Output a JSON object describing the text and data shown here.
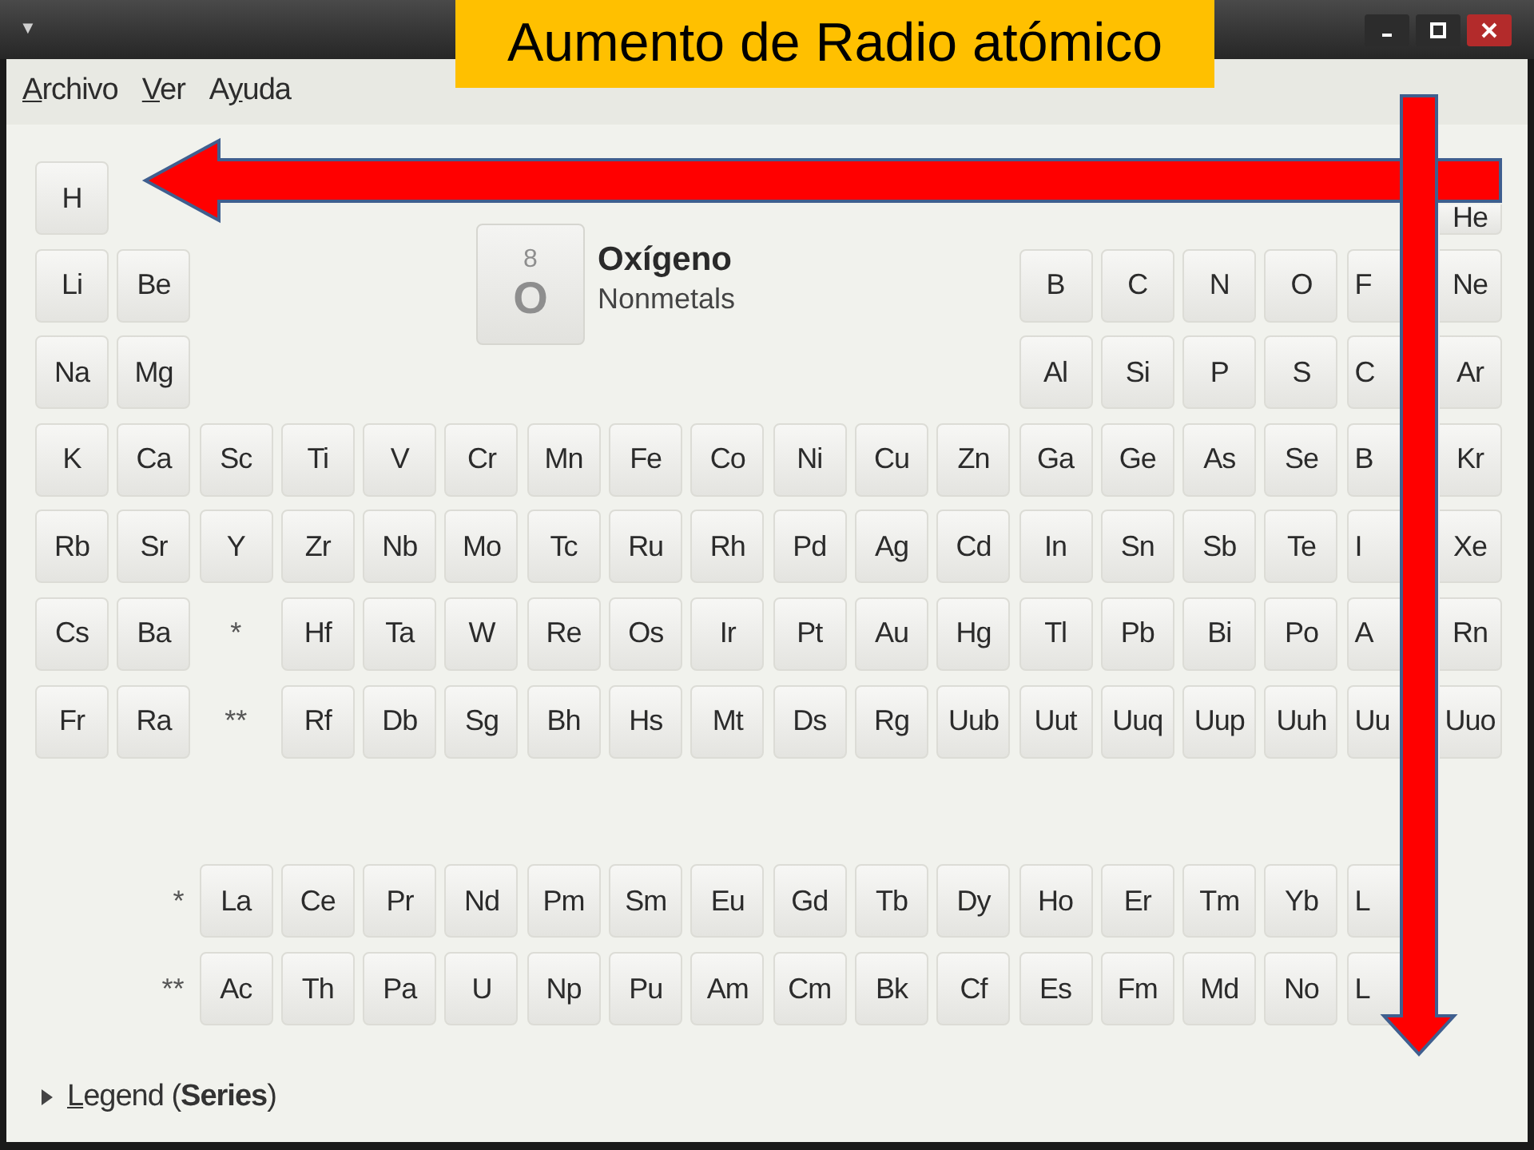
{
  "annotation": {
    "title": "Aumento de Radio atómico"
  },
  "window": {
    "menu_glyph": "▼",
    "controls": [
      {
        "kind": "minimize"
      },
      {
        "kind": "maximize"
      },
      {
        "kind": "close"
      }
    ]
  },
  "menu": [
    {
      "key": "A",
      "rest": "rchivo"
    },
    {
      "key": "V",
      "rest": "er"
    },
    {
      "prefix": "A",
      "key": "y",
      "rest": "uda"
    }
  ],
  "selected_element": {
    "number": "8",
    "symbol": "O",
    "name": "Oxígeno",
    "series": "Nonmetals"
  },
  "table": [
    [
      {
        "symbol": "H"
      },
      {
        "symbol": "He"
      }
    ],
    [
      {
        "symbol": "Li"
      },
      {
        "symbol": "Be"
      },
      {
        "symbol": "B"
      },
      {
        "symbol": "C"
      },
      {
        "symbol": "N"
      },
      {
        "symbol": "O"
      },
      {
        "symbol": "F"
      },
      {
        "symbol": "Ne"
      }
    ],
    [
      {
        "symbol": "Na"
      },
      {
        "symbol": "Mg"
      },
      {
        "symbol": "Al"
      },
      {
        "symbol": "Si"
      },
      {
        "symbol": "P"
      },
      {
        "symbol": "S"
      },
      {
        "symbol": "C"
      },
      {
        "symbol": "Ar"
      }
    ],
    [
      {
        "symbol": "K"
      },
      {
        "symbol": "Ca"
      },
      {
        "symbol": "Sc"
      },
      {
        "symbol": "Ti"
      },
      {
        "symbol": "V"
      },
      {
        "symbol": "Cr"
      },
      {
        "symbol": "Mn"
      },
      {
        "symbol": "Fe"
      },
      {
        "symbol": "Co"
      },
      {
        "symbol": "Ni"
      },
      {
        "symbol": "Cu"
      },
      {
        "symbol": "Zn"
      },
      {
        "symbol": "Ga"
      },
      {
        "symbol": "Ge"
      },
      {
        "symbol": "As"
      },
      {
        "symbol": "Se"
      },
      {
        "symbol": "B"
      },
      {
        "symbol": "Kr"
      }
    ],
    [
      {
        "symbol": "Rb"
      },
      {
        "symbol": "Sr"
      },
      {
        "symbol": "Y"
      },
      {
        "symbol": "Zr"
      },
      {
        "symbol": "Nb"
      },
      {
        "symbol": "Mo"
      },
      {
        "symbol": "Tc"
      },
      {
        "symbol": "Ru"
      },
      {
        "symbol": "Rh"
      },
      {
        "symbol": "Pd"
      },
      {
        "symbol": "Ag"
      },
      {
        "symbol": "Cd"
      },
      {
        "symbol": "In"
      },
      {
        "symbol": "Sn"
      },
      {
        "symbol": "Sb"
      },
      {
        "symbol": "Te"
      },
      {
        "symbol": "I"
      },
      {
        "symbol": "Xe"
      }
    ],
    [
      {
        "symbol": "Cs"
      },
      {
        "symbol": "Ba"
      },
      {
        "kind": "marker",
        "symbol": "*"
      },
      {
        "symbol": "Hf"
      },
      {
        "symbol": "Ta"
      },
      {
        "symbol": "W"
      },
      {
        "symbol": "Re"
      },
      {
        "symbol": "Os"
      },
      {
        "symbol": "Ir"
      },
      {
        "symbol": "Pt"
      },
      {
        "symbol": "Au"
      },
      {
        "symbol": "Hg"
      },
      {
        "symbol": "Tl"
      },
      {
        "symbol": "Pb"
      },
      {
        "symbol": "Bi"
      },
      {
        "symbol": "Po"
      },
      {
        "symbol": "A"
      },
      {
        "symbol": "Rn"
      }
    ],
    [
      {
        "symbol": "Fr"
      },
      {
        "symbol": "Ra"
      },
      {
        "kind": "marker",
        "symbol": "**"
      },
      {
        "symbol": "Rf"
      },
      {
        "symbol": "Db"
      },
      {
        "symbol": "Sg"
      },
      {
        "symbol": "Bh"
      },
      {
        "symbol": "Hs"
      },
      {
        "symbol": "Mt"
      },
      {
        "symbol": "Ds"
      },
      {
        "symbol": "Rg"
      },
      {
        "symbol": "Uub"
      },
      {
        "symbol": "Uut"
      },
      {
        "symbol": "Uuq"
      },
      {
        "symbol": "Uup"
      },
      {
        "symbol": "Uuh"
      },
      {
        "symbol": "Uu"
      },
      {
        "symbol": "Uuo"
      }
    ]
  ],
  "f_block": [
    [
      {
        "kind": "marker",
        "symbol": "*"
      },
      {
        "symbol": "La"
      },
      {
        "symbol": "Ce"
      },
      {
        "symbol": "Pr"
      },
      {
        "symbol": "Nd"
      },
      {
        "symbol": "Pm"
      },
      {
        "symbol": "Sm"
      },
      {
        "symbol": "Eu"
      },
      {
        "symbol": "Gd"
      },
      {
        "symbol": "Tb"
      },
      {
        "symbol": "Dy"
      },
      {
        "symbol": "Ho"
      },
      {
        "symbol": "Er"
      },
      {
        "symbol": "Tm"
      },
      {
        "symbol": "Yb"
      },
      {
        "symbol": "L"
      }
    ],
    [
      {
        "kind": "marker",
        "symbol": "**"
      },
      {
        "symbol": "Ac"
      },
      {
        "symbol": "Th"
      },
      {
        "symbol": "Pa"
      },
      {
        "symbol": "U"
      },
      {
        "symbol": "Np"
      },
      {
        "symbol": "Pu"
      },
      {
        "symbol": "Am"
      },
      {
        "symbol": "Cm"
      },
      {
        "symbol": "Bk"
      },
      {
        "symbol": "Cf"
      },
      {
        "symbol": "Es"
      },
      {
        "symbol": "Fm"
      },
      {
        "symbol": "Md"
      },
      {
        "symbol": "No"
      },
      {
        "symbol": "L"
      }
    ]
  ],
  "legend": {
    "expanded": false,
    "key": "L",
    "text": "egend (**Series**)"
  }
}
